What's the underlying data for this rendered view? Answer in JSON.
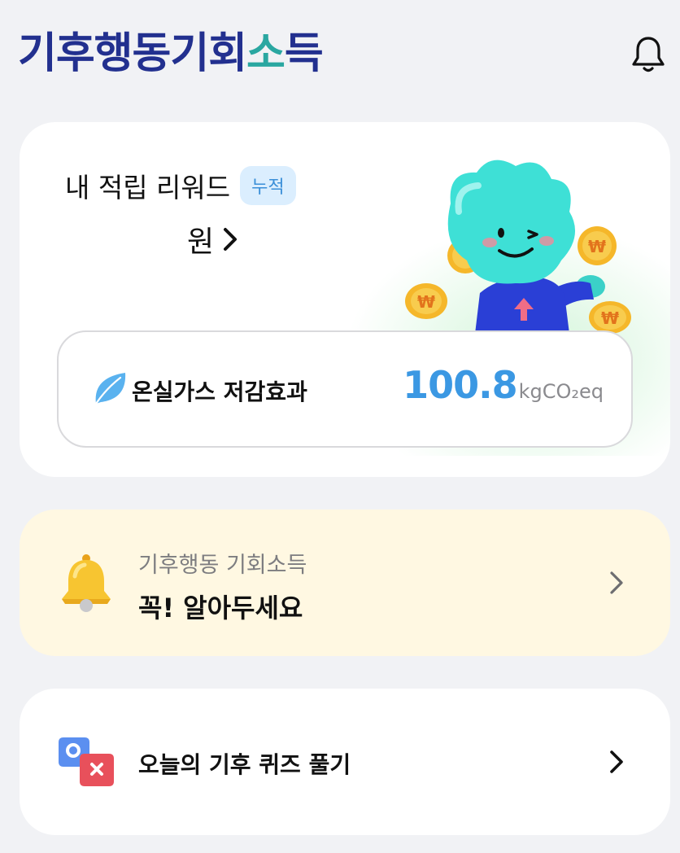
{
  "header": {
    "logo_prefix": "기",
    "logo_mid1": "후행동기회",
    "logo_mid2": "소",
    "logo_suffix": "득",
    "bell_icon": "bell-icon"
  },
  "reward": {
    "title": "내 적립 리워드",
    "badge": "누적",
    "amount_unit": "원",
    "ghg_label": "온실가스 저감효과",
    "ghg_value": "100.8",
    "ghg_unit": "kgCO₂eq"
  },
  "notice": {
    "subtitle": "기후행동 기회소득",
    "title": "꼭! 알아두세요"
  },
  "quiz": {
    "label": "오늘의 기후 퀴즈 풀기"
  },
  "colors": {
    "brand_navy": "#22308f",
    "accent_blue": "#3b98e3",
    "notice_bg": "#fff8e2",
    "page_bg": "#f1f2f5"
  }
}
